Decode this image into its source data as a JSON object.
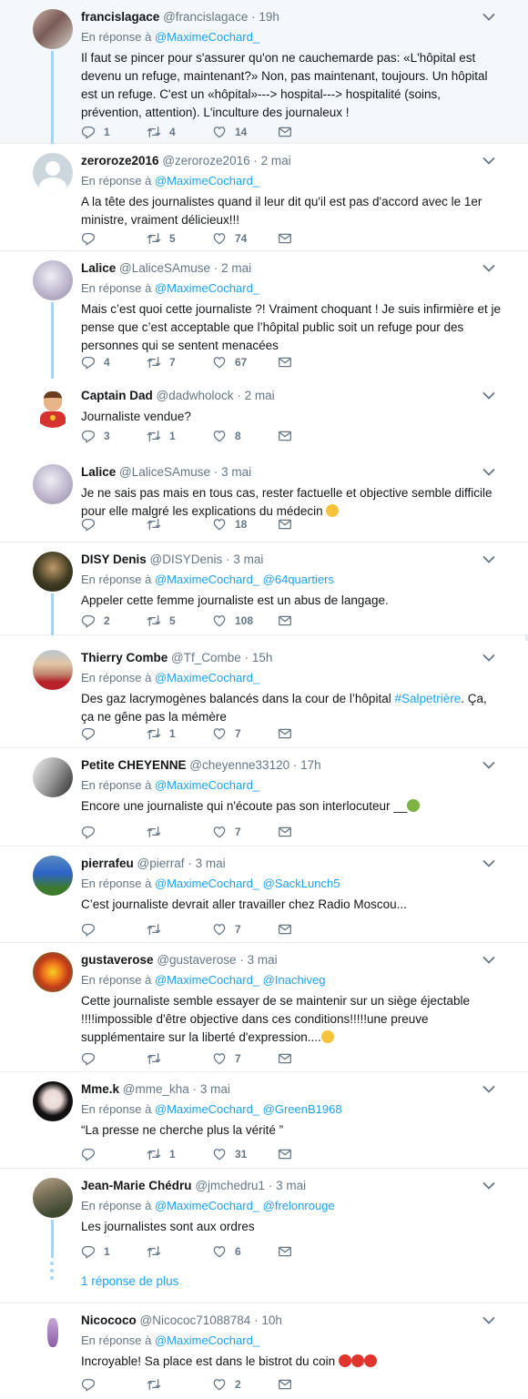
{
  "reply_prefix": "En réponse à",
  "more_replies": "1 réponse de plus",
  "tweets": [
    {
      "name": "francislagace",
      "handle": "@francislagace",
      "time": "19h",
      "mentions": [
        "@MaximeCochard_"
      ],
      "text": "Il faut se pincer pour s'assurer qu'on ne cauchemarde pas: «L'hôpital est devenu un refuge, maintenant?» Non, pas maintenant, toujours. Un hôpital est un refuge. C'est un «hôpital»---> hospital---> hospitalité (soins, prévention, attention). L'inculture des journaleux !",
      "replies": "1",
      "retweets": "4",
      "likes": "14"
    },
    {
      "name": "zeroroze2016",
      "handle": "@zeroroze2016",
      "time": "2 mai",
      "mentions": [
        "@MaximeCochard_"
      ],
      "text": "A la tête des journalistes quand il leur dit qu'il est pas d'accord avec le 1er ministre, vraiment délicieux!!!",
      "replies": "",
      "retweets": "5",
      "likes": "74"
    },
    {
      "name": "Lalice",
      "handle": "@LaliceSAmuse",
      "time": "2 mai",
      "mentions": [
        "@MaximeCochard_"
      ],
      "text": "Mais c’est quoi cette journaliste ?! Vraiment choquant ! Je suis infirmière et je pense que c’est acceptable que l’hôpital public soit un refuge pour des personnes qui se sentent menacées",
      "replies": "4",
      "retweets": "7",
      "likes": "67"
    },
    {
      "name": "Captain Dad",
      "handle": "@dadwholock",
      "time": "2 mai",
      "mentions": [],
      "text": "Journaliste vendue?",
      "replies": "3",
      "retweets": "1",
      "likes": "8"
    },
    {
      "name": "Lalice",
      "handle": "@LaliceSAmuse",
      "time": "3 mai",
      "mentions": [],
      "text": "Je ne sais pas mais en tous cas, rester factuelle et objective semble difficile pour elle malgré les explications du médecin",
      "replies": "",
      "retweets": "",
      "likes": "18"
    },
    {
      "name": "DISY Denis",
      "handle": "@DISYDenis",
      "time": "3 mai",
      "mentions": [
        "@MaximeCochard_",
        "@64quartiers"
      ],
      "text": "Appeler cette femme journaliste est un abus de langage.",
      "replies": "2",
      "retweets": "5",
      "likes": "108"
    },
    {
      "name": "Thierry Combe",
      "handle": "@Tf_Combe",
      "time": "15h",
      "mentions": [
        "@MaximeCochard_"
      ],
      "text_before": "Des gaz lacrymogènes balancés dans la cour de l’hôpital ",
      "hashtag": "#Salpetrière",
      "text_after": ". Ça, ça ne gêne pas la mémère",
      "replies": "",
      "retweets": "1",
      "likes": "7"
    },
    {
      "name": "Petite CHEYENNE",
      "handle": "@cheyenne33120",
      "time": "17h",
      "mentions": [
        "@MaximeCochard_"
      ],
      "text": "Encore une journaliste qui n'écoute pas son interlocuteur __",
      "replies": "",
      "retweets": "",
      "likes": "7"
    },
    {
      "name": "pierrafeu",
      "handle": "@pierraf",
      "time": "3 mai",
      "mentions": [
        "@MaximeCochard_",
        "@SackLunch5"
      ],
      "text": "C’est journaliste devrait aller travailler chez Radio Moscou...",
      "replies": "",
      "retweets": "",
      "likes": "7"
    },
    {
      "name": "gustaverose",
      "handle": "@gustaverose",
      "time": "3 mai",
      "mentions": [
        "@MaximeCochard_",
        "@Inachiveg"
      ],
      "text": "Cette journaliste semble essayer de se maintenir sur un siège éjectable !!!!impossible d'être objective dans ces conditions!!!!!une preuve supplémentaire sur la liberté d'expression....",
      "replies": "",
      "retweets": "",
      "likes": "7"
    },
    {
      "name": "Mme.k",
      "handle": "@mme_kha",
      "time": "3 mai",
      "mentions": [
        "@MaximeCochard_",
        "@GreenB1968"
      ],
      "text": "“La presse ne cherche plus la vérité ”",
      "replies": "",
      "retweets": "1",
      "likes": "31"
    },
    {
      "name": "Jean-Marie Chédru",
      "handle": "@jmchedru1",
      "time": "3 mai",
      "mentions": [
        "@MaximeCochard_",
        "@frelonrouge"
      ],
      "text": "Les journalistes sont aux ordres",
      "replies": "1",
      "retweets": "",
      "likes": "6"
    },
    {
      "name": "Nicococo",
      "handle": "@Nicococ71088784",
      "time": "10h",
      "mentions": [
        "@MaximeCochard_"
      ],
      "text": "Incroyable! Sa place est dans le bistrot du coin",
      "replies": "",
      "retweets": "",
      "likes": "2"
    }
  ],
  "colors": {
    "link": "#1da1f2",
    "muted": "#657786",
    "thread": "#a8d5f3",
    "border": "#e6ecf0"
  }
}
